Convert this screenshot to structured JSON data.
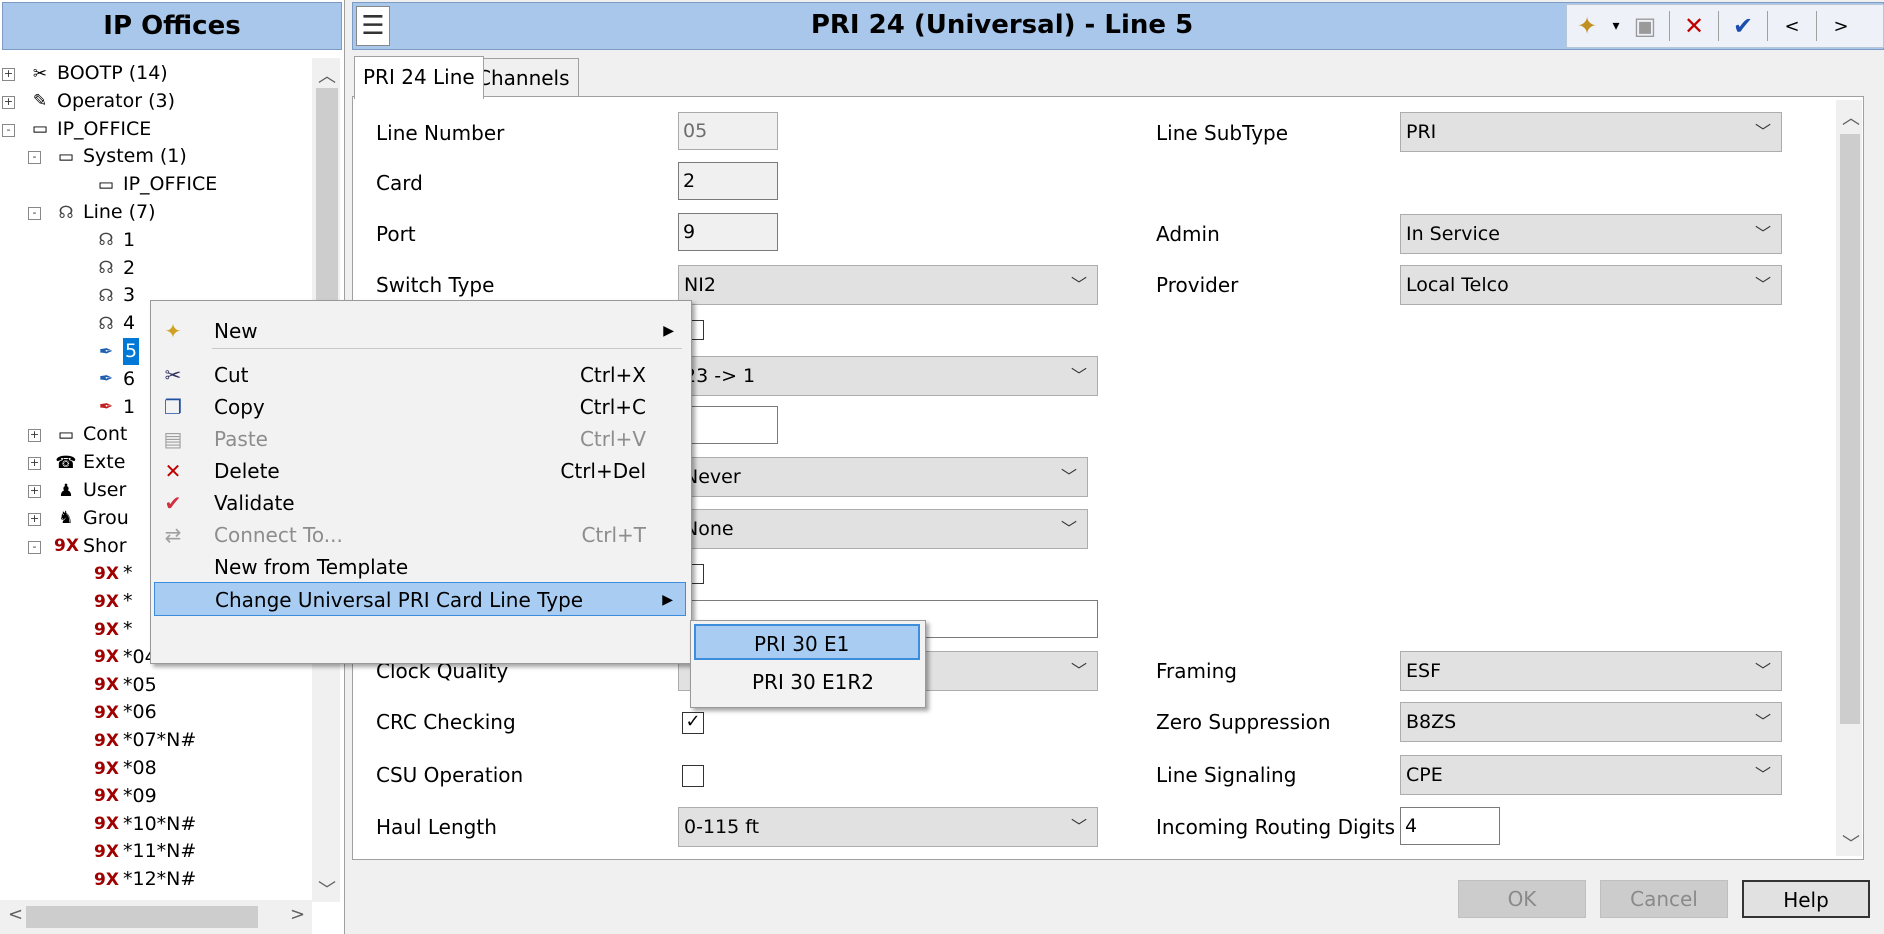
{
  "left": {
    "header": "IP Offices",
    "tree": [
      {
        "label": "BOOTP (14)",
        "icon": "bootp-icon",
        "glyph": "✂"
      },
      {
        "label": "Operator (3)",
        "icon": "operator-icon",
        "glyph": "✎"
      },
      {
        "label": "IP_OFFICE",
        "icon": "ip-office-icon",
        "glyph": "▭"
      },
      {
        "label": "System (1)",
        "icon": "system-icon",
        "glyph": "▭"
      },
      {
        "label": "IP_OFFICE",
        "icon": "system-unit-icon",
        "glyph": "▭"
      },
      {
        "label": "Line (7)",
        "icon": "line-icon",
        "glyph": "☊"
      },
      {
        "label": "1",
        "icon": "line-icon",
        "glyph": "☊"
      },
      {
        "label": "2",
        "icon": "line-icon",
        "glyph": "☊"
      },
      {
        "label": "3",
        "icon": "line-icon",
        "glyph": "☊"
      },
      {
        "label": "4",
        "icon": "line-icon",
        "glyph": "☊"
      },
      {
        "label": "5",
        "icon": "sip-line-icon",
        "glyph": "✒"
      },
      {
        "label": "6",
        "icon": "sip-line-icon",
        "glyph": "✒"
      },
      {
        "label": "1",
        "icon": "red-line-icon",
        "glyph": "✒"
      },
      {
        "label": "Cont",
        "icon": "control-unit-icon",
        "glyph": "▭"
      },
      {
        "label": "Exte",
        "icon": "extension-icon",
        "glyph": "☎"
      },
      {
        "label": "User",
        "icon": "user-icon",
        "glyph": "♟"
      },
      {
        "label": "Grou",
        "icon": "group-icon",
        "glyph": "♞"
      },
      {
        "label": "Shor",
        "icon": "short-code-icon",
        "glyph": "9X"
      },
      {
        "label": "*",
        "icon": "short-code-icon",
        "glyph": "9X"
      },
      {
        "label": "*",
        "icon": "short-code-icon",
        "glyph": "9X"
      },
      {
        "label": "*",
        "icon": "short-code-icon",
        "glyph": "9X"
      },
      {
        "label": "*04",
        "icon": "short-code-icon",
        "glyph": "9X"
      },
      {
        "label": "*05",
        "icon": "short-code-icon",
        "glyph": "9X"
      },
      {
        "label": "*06",
        "icon": "short-code-icon",
        "glyph": "9X"
      },
      {
        "label": "*07*N#",
        "icon": "short-code-icon",
        "glyph": "9X"
      },
      {
        "label": "*08",
        "icon": "short-code-icon",
        "glyph": "9X"
      },
      {
        "label": "*09",
        "icon": "short-code-icon",
        "glyph": "9X"
      },
      {
        "label": "*10*N#",
        "icon": "short-code-icon",
        "glyph": "9X"
      },
      {
        "label": "*11*N#",
        "icon": "short-code-icon",
        "glyph": "9X"
      },
      {
        "label": "*12*N#",
        "icon": "short-code-icon",
        "glyph": "9X"
      }
    ]
  },
  "title": "PRI 24 (Universal) - Line 5",
  "toolbar": {
    "dropdown_glyph": "▾",
    "delete_glyph": "✕",
    "validate_glyph": "✔",
    "prev_glyph": "<",
    "next_glyph": ">"
  },
  "tabs": [
    "PRI 24 Line",
    "Channels"
  ],
  "form": {
    "line_number_label": "Line Number",
    "line_number_value": "05",
    "card_label": "Card",
    "card_value": "2",
    "port_label": "Port",
    "port_value": "9",
    "switch_type_label": "Switch Type",
    "switch_type_value": "NI2",
    "channel_alloc_value": "23 -> 1",
    "hidden_sel_1_value": "Never",
    "hidden_sel_2_value": "None",
    "clock_quality_label": "Clock Quality",
    "crc_label": "CRC Checking",
    "crc_checked": "✓",
    "csu_label": "CSU Operation",
    "haul_label": "Haul Length",
    "haul_value": "0-115 ft",
    "subtype_label": "Line SubType",
    "subtype_value": "PRI",
    "admin_label": "Admin",
    "admin_value": "In Service",
    "provider_label": "Provider",
    "provider_value": "Local Telco",
    "framing_label": "Framing",
    "framing_value": "ESF",
    "zero_label": "Zero Suppression",
    "zero_value": "B8ZS",
    "signaling_label": "Line Signaling",
    "signaling_value": "CPE",
    "routing_label": "Incoming Routing Digits",
    "routing_value": "4"
  },
  "buttons": {
    "ok": "OK",
    "cancel": "Cancel",
    "help": "Help"
  },
  "context_menu": {
    "items": [
      {
        "label": "New",
        "shortcut": "",
        "icon": "new-icon",
        "glyph": "✦",
        "submenu": true
      },
      {
        "label": "Cut",
        "shortcut": "Ctrl+X",
        "icon": "cut-icon",
        "glyph": "✂"
      },
      {
        "label": "Copy",
        "shortcut": "Ctrl+C",
        "icon": "copy-icon",
        "glyph": "❐"
      },
      {
        "label": "Paste",
        "shortcut": "Ctrl+V",
        "icon": "paste-icon",
        "glyph": "▤",
        "disabled": true
      },
      {
        "label": "Delete",
        "shortcut": "Ctrl+Del",
        "icon": "delete-icon",
        "glyph": "✕"
      },
      {
        "label": "Validate",
        "shortcut": "",
        "icon": "validate-icon",
        "glyph": "✔"
      },
      {
        "label": "Connect To...",
        "shortcut": "Ctrl+T",
        "icon": "connect-icon",
        "glyph": "⇄",
        "disabled": true
      },
      {
        "label": "New from Template",
        "shortcut": "",
        "icon": "",
        "glyph": ""
      },
      {
        "label": "Change Universal PRI Card Line Type",
        "shortcut": "",
        "icon": "",
        "glyph": "",
        "submenu": true,
        "highlighted": true
      }
    ],
    "submenu": [
      "PRI 30 E1",
      "PRI 30 E1R2"
    ]
  },
  "colors": {
    "header_bg": "#a9c7ea",
    "highlight": "#a9cdf2",
    "selection": "#0078d7"
  }
}
